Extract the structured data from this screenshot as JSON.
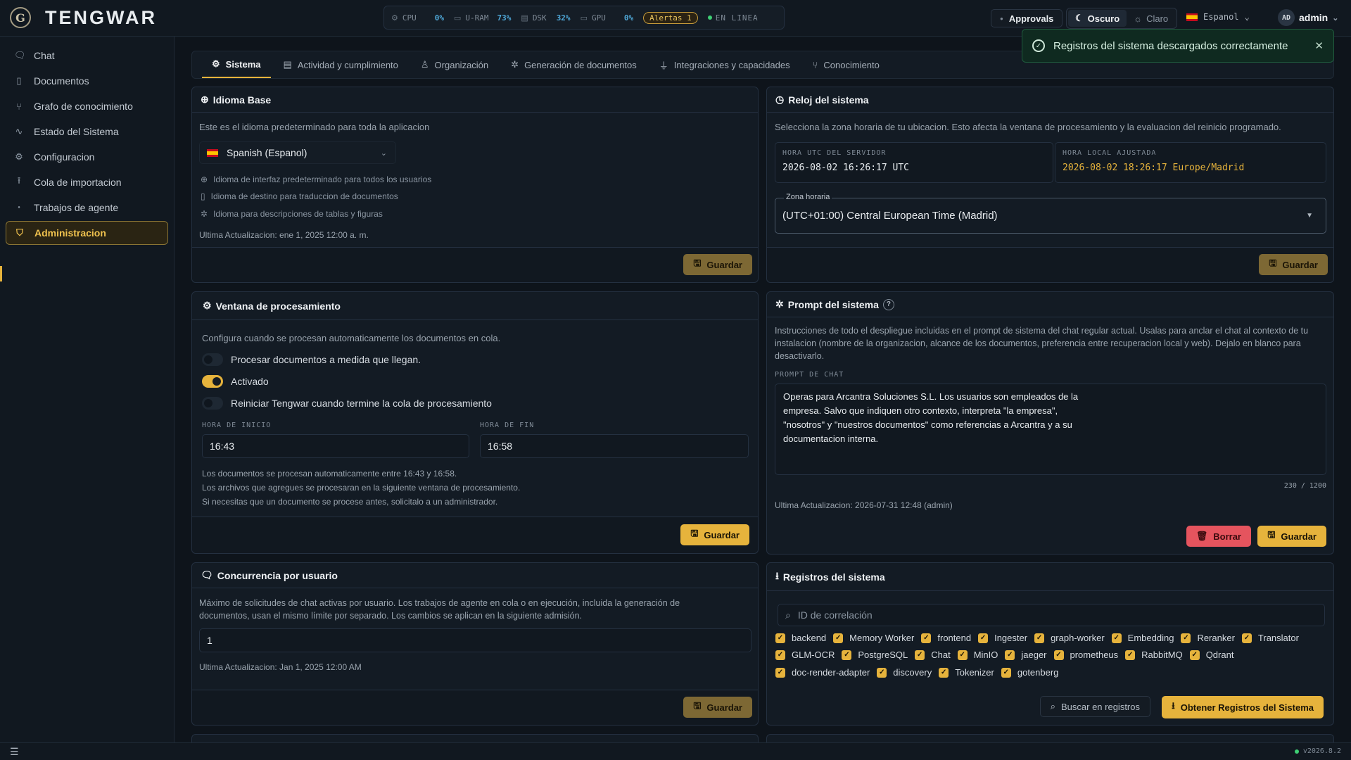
{
  "app": {
    "title": "TENGWAR",
    "logo_letter": "G"
  },
  "metrics": [
    {
      "label": "CPU",
      "value": "0%"
    },
    {
      "label": "U-RAM",
      "value": "73%"
    },
    {
      "label": "DSK",
      "value": "32%"
    },
    {
      "label": "GPU",
      "value": "0%"
    }
  ],
  "alerts": "Alertas 1",
  "online": "EN LINEA",
  "header": {
    "approvals": "Approvals",
    "theme_dark": "Oscuro",
    "theme_light": "Claro",
    "language": "Espanol",
    "user": "admin",
    "avatar": "AD"
  },
  "sidebar": {
    "items": [
      {
        "label": "Chat",
        "icon": "chat-icon"
      },
      {
        "label": "Documentos",
        "icon": "document-icon"
      },
      {
        "label": "Grafo de conocimiento",
        "icon": "graph-icon"
      },
      {
        "label": "Estado del Sistema",
        "icon": "activity-icon"
      },
      {
        "label": "Configuracion",
        "icon": "gear-icon"
      },
      {
        "label": "Cola de importacion",
        "icon": "upload-icon"
      },
      {
        "label": "Trabajos de agente",
        "icon": "dot-icon"
      },
      {
        "label": "Administracion",
        "icon": "shield-icon"
      }
    ]
  },
  "version": "v2026.8.2",
  "tabs": [
    "Sistema",
    "Actividad y cumplimiento",
    "Organización",
    "Generación de documentos",
    "Integraciones y capacidades",
    "Conocimiento"
  ],
  "toast": "Registros del sistema descargados correctamente",
  "idioma": {
    "title": "Idioma Base",
    "desc": "Este es el idioma predeterminado para toda la aplicacion",
    "selected": "Spanish (Espanol)",
    "bullets": [
      "Idioma de interfaz predeterminado para todos los usuarios",
      "Idioma de destino para traduccion de documentos",
      "Idioma para descripciones de tablas y figuras"
    ],
    "updated": "Ultima Actualizacion: ene 1, 2025 12:00 a. m.",
    "save": "Guardar"
  },
  "reloj": {
    "title": "Reloj del sistema",
    "desc": "Selecciona la zona horaria de tu ubicacion. Esto afecta la ventana de procesamiento y la evaluacion del reinicio programado.",
    "utc_label": "HORA UTC DEL SERVIDOR",
    "utc_value": "2026-08-02 16:26:17 UTC",
    "local_label": "HORA LOCAL AJUSTADA",
    "local_value": "2026-08-02 18:26:17 Europe/Madrid",
    "tz_label": "Zona horaria",
    "tz_value": "(UTC+01:00) Central European Time (Madrid)",
    "save": "Guardar"
  },
  "ventana": {
    "title": "Ventana de procesamiento",
    "desc": "Configura cuando se procesan automaticamente los documentos en cola.",
    "toggles": [
      {
        "label": "Procesar documentos a medida que llegan.",
        "on": false
      },
      {
        "label": "Activado",
        "on": true
      },
      {
        "label": "Reiniciar Tengwar cuando termine la cola de procesamiento",
        "on": false
      }
    ],
    "start_label": "HORA DE INICIO",
    "start": "16:43",
    "end_label": "HORA DE FIN",
    "end": "16:58",
    "info": [
      "Los documentos se procesan automaticamente entre 16:43 y 16:58.",
      "Los archivos que agregues se procesaran en la siguiente ventana de procesamiento.",
      "Si necesitas que un documento se procese antes, solicitalo a un administrador."
    ],
    "save": "Guardar"
  },
  "prompt": {
    "title": "Prompt del sistema",
    "desc": "Instrucciones de todo el despliegue incluidas en el prompt de sistema del chat regular actual. Usalas para anclar el chat al contexto de tu instalacion (nombre de la organizacion, alcance de los documentos, preferencia entre recuperacion local y web). Dejalo en blanco para desactivarlo.",
    "label": "PROMPT DE CHAT",
    "lines": [
      "Operas para Arcantra Soluciones S.L. Los usuarios son empleados de la",
      "empresa. Salvo que indiquen otro contexto, interpreta \"la empresa\",",
      "\"nosotros\" y \"nuestros documentos\" como referencias a Arcantra y a su",
      "documentacion interna."
    ],
    "count": "230 / 1200",
    "updated": "Ultima Actualizacion: 2026-07-31 12:48 (admin)",
    "delete": "Borrar",
    "save": "Guardar"
  },
  "concurrencia": {
    "title": "Concurrencia por usuario",
    "desc1": "Máximo de solicitudes de chat activas por usuario. Los trabajos de agente en cola o en ejecución, incluida la generación de",
    "desc2": "documentos, usan el mismo límite por separado. Los cambios se aplican en la siguiente admisión.",
    "value": "1",
    "updated": "Ultima Actualizacion: Jan 1, 2025 12:00 AM",
    "save": "Guardar"
  },
  "registros": {
    "title": "Registros del sistema",
    "search_placeholder": "ID de correlación",
    "rows": [
      [
        "backend",
        "Memory Worker",
        "frontend",
        "Ingester",
        "graph-worker",
        "Embedding",
        "Reranker",
        "Translator"
      ],
      [
        "GLM-OCR",
        "PostgreSQL",
        "Chat",
        "MinIO",
        "jaeger",
        "prometheus",
        "RabbitMQ",
        "Qdrant"
      ],
      [
        "doc-render-adapter",
        "discovery",
        "Tokenizer",
        "gotenberg"
      ]
    ],
    "search_logs": "Buscar en registros",
    "get_logs": "Obtener Registros del Sistema"
  },
  "colors": {
    "accent": "#e6b33c",
    "bg": "#0e141b",
    "panel": "#131b24",
    "danger": "#e5545e",
    "success": "#3ecf74"
  }
}
